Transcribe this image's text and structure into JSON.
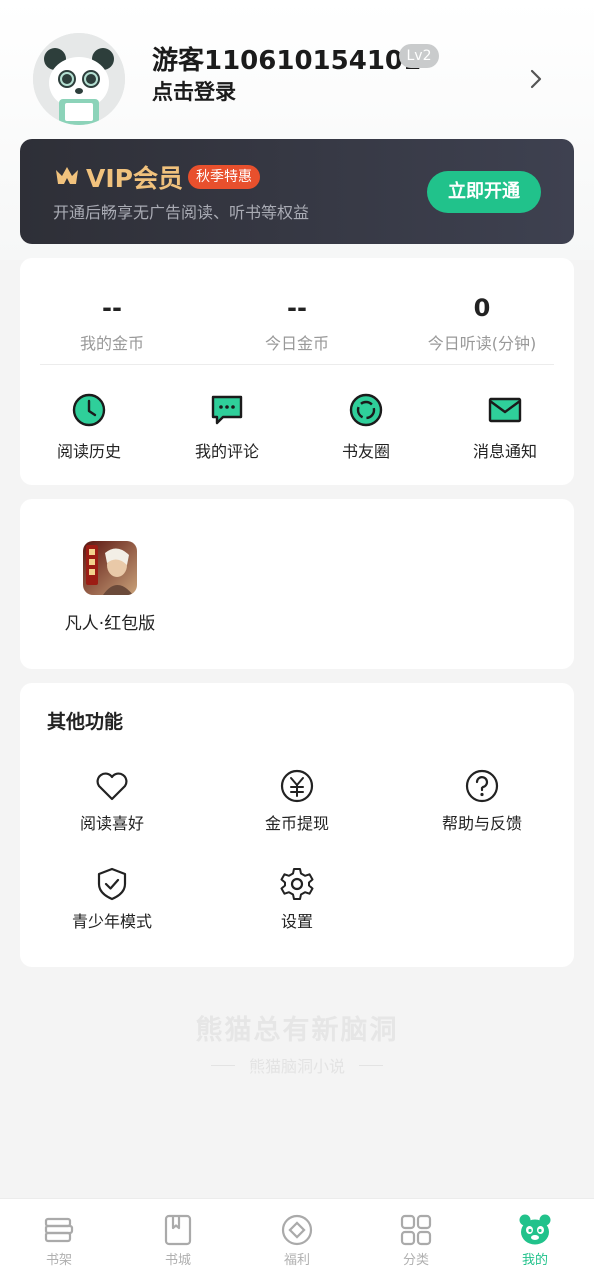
{
  "profile": {
    "username": "游客110610154101",
    "level": "Lv2",
    "login_prompt": "点击登录"
  },
  "vip": {
    "title": "VIP会员",
    "tag": "秋季特惠",
    "description": "开通后畅享无广告阅读、听书等权益",
    "button": "立即开通",
    "colors": {
      "title": "#f1c27d",
      "tag": "#e8502d",
      "button": "#21c28b"
    }
  },
  "stats": [
    {
      "value": "--",
      "label": "我的金币"
    },
    {
      "value": "--",
      "label": "今日金币"
    },
    {
      "value": "0",
      "label": "今日听读(分钟)"
    }
  ],
  "quick_actions": [
    {
      "label": "阅读历史",
      "icon": "clock-icon"
    },
    {
      "label": "我的评论",
      "icon": "comment-icon"
    },
    {
      "label": "书友圈",
      "icon": "circle-icon"
    },
    {
      "label": "消息通知",
      "icon": "mail-icon"
    }
  ],
  "games": [
    {
      "label": "凡人·红包版",
      "icon": "game-cover-icon"
    }
  ],
  "other": {
    "title": "其他功能",
    "items": [
      {
        "label": "阅读喜好",
        "icon": "heart-icon"
      },
      {
        "label": "金币提现",
        "icon": "yuan-icon"
      },
      {
        "label": "帮助与反馈",
        "icon": "help-icon"
      },
      {
        "label": "青少年模式",
        "icon": "shield-icon"
      },
      {
        "label": "设置",
        "icon": "gear-icon"
      }
    ]
  },
  "watermark": {
    "main": "熊猫总有新脑洞",
    "sub": "熊猫脑洞小说"
  },
  "tabs": [
    {
      "label": "书架",
      "icon": "bookshelf-icon",
      "active": false
    },
    {
      "label": "书城",
      "icon": "book-icon",
      "active": false
    },
    {
      "label": "福利",
      "icon": "coin-icon",
      "active": false
    },
    {
      "label": "分类",
      "icon": "grid-icon",
      "active": false
    },
    {
      "label": "我的",
      "icon": "panda-icon",
      "active": true
    }
  ],
  "theme": {
    "accent": "#21c28b",
    "background": "#f4f4f4"
  }
}
